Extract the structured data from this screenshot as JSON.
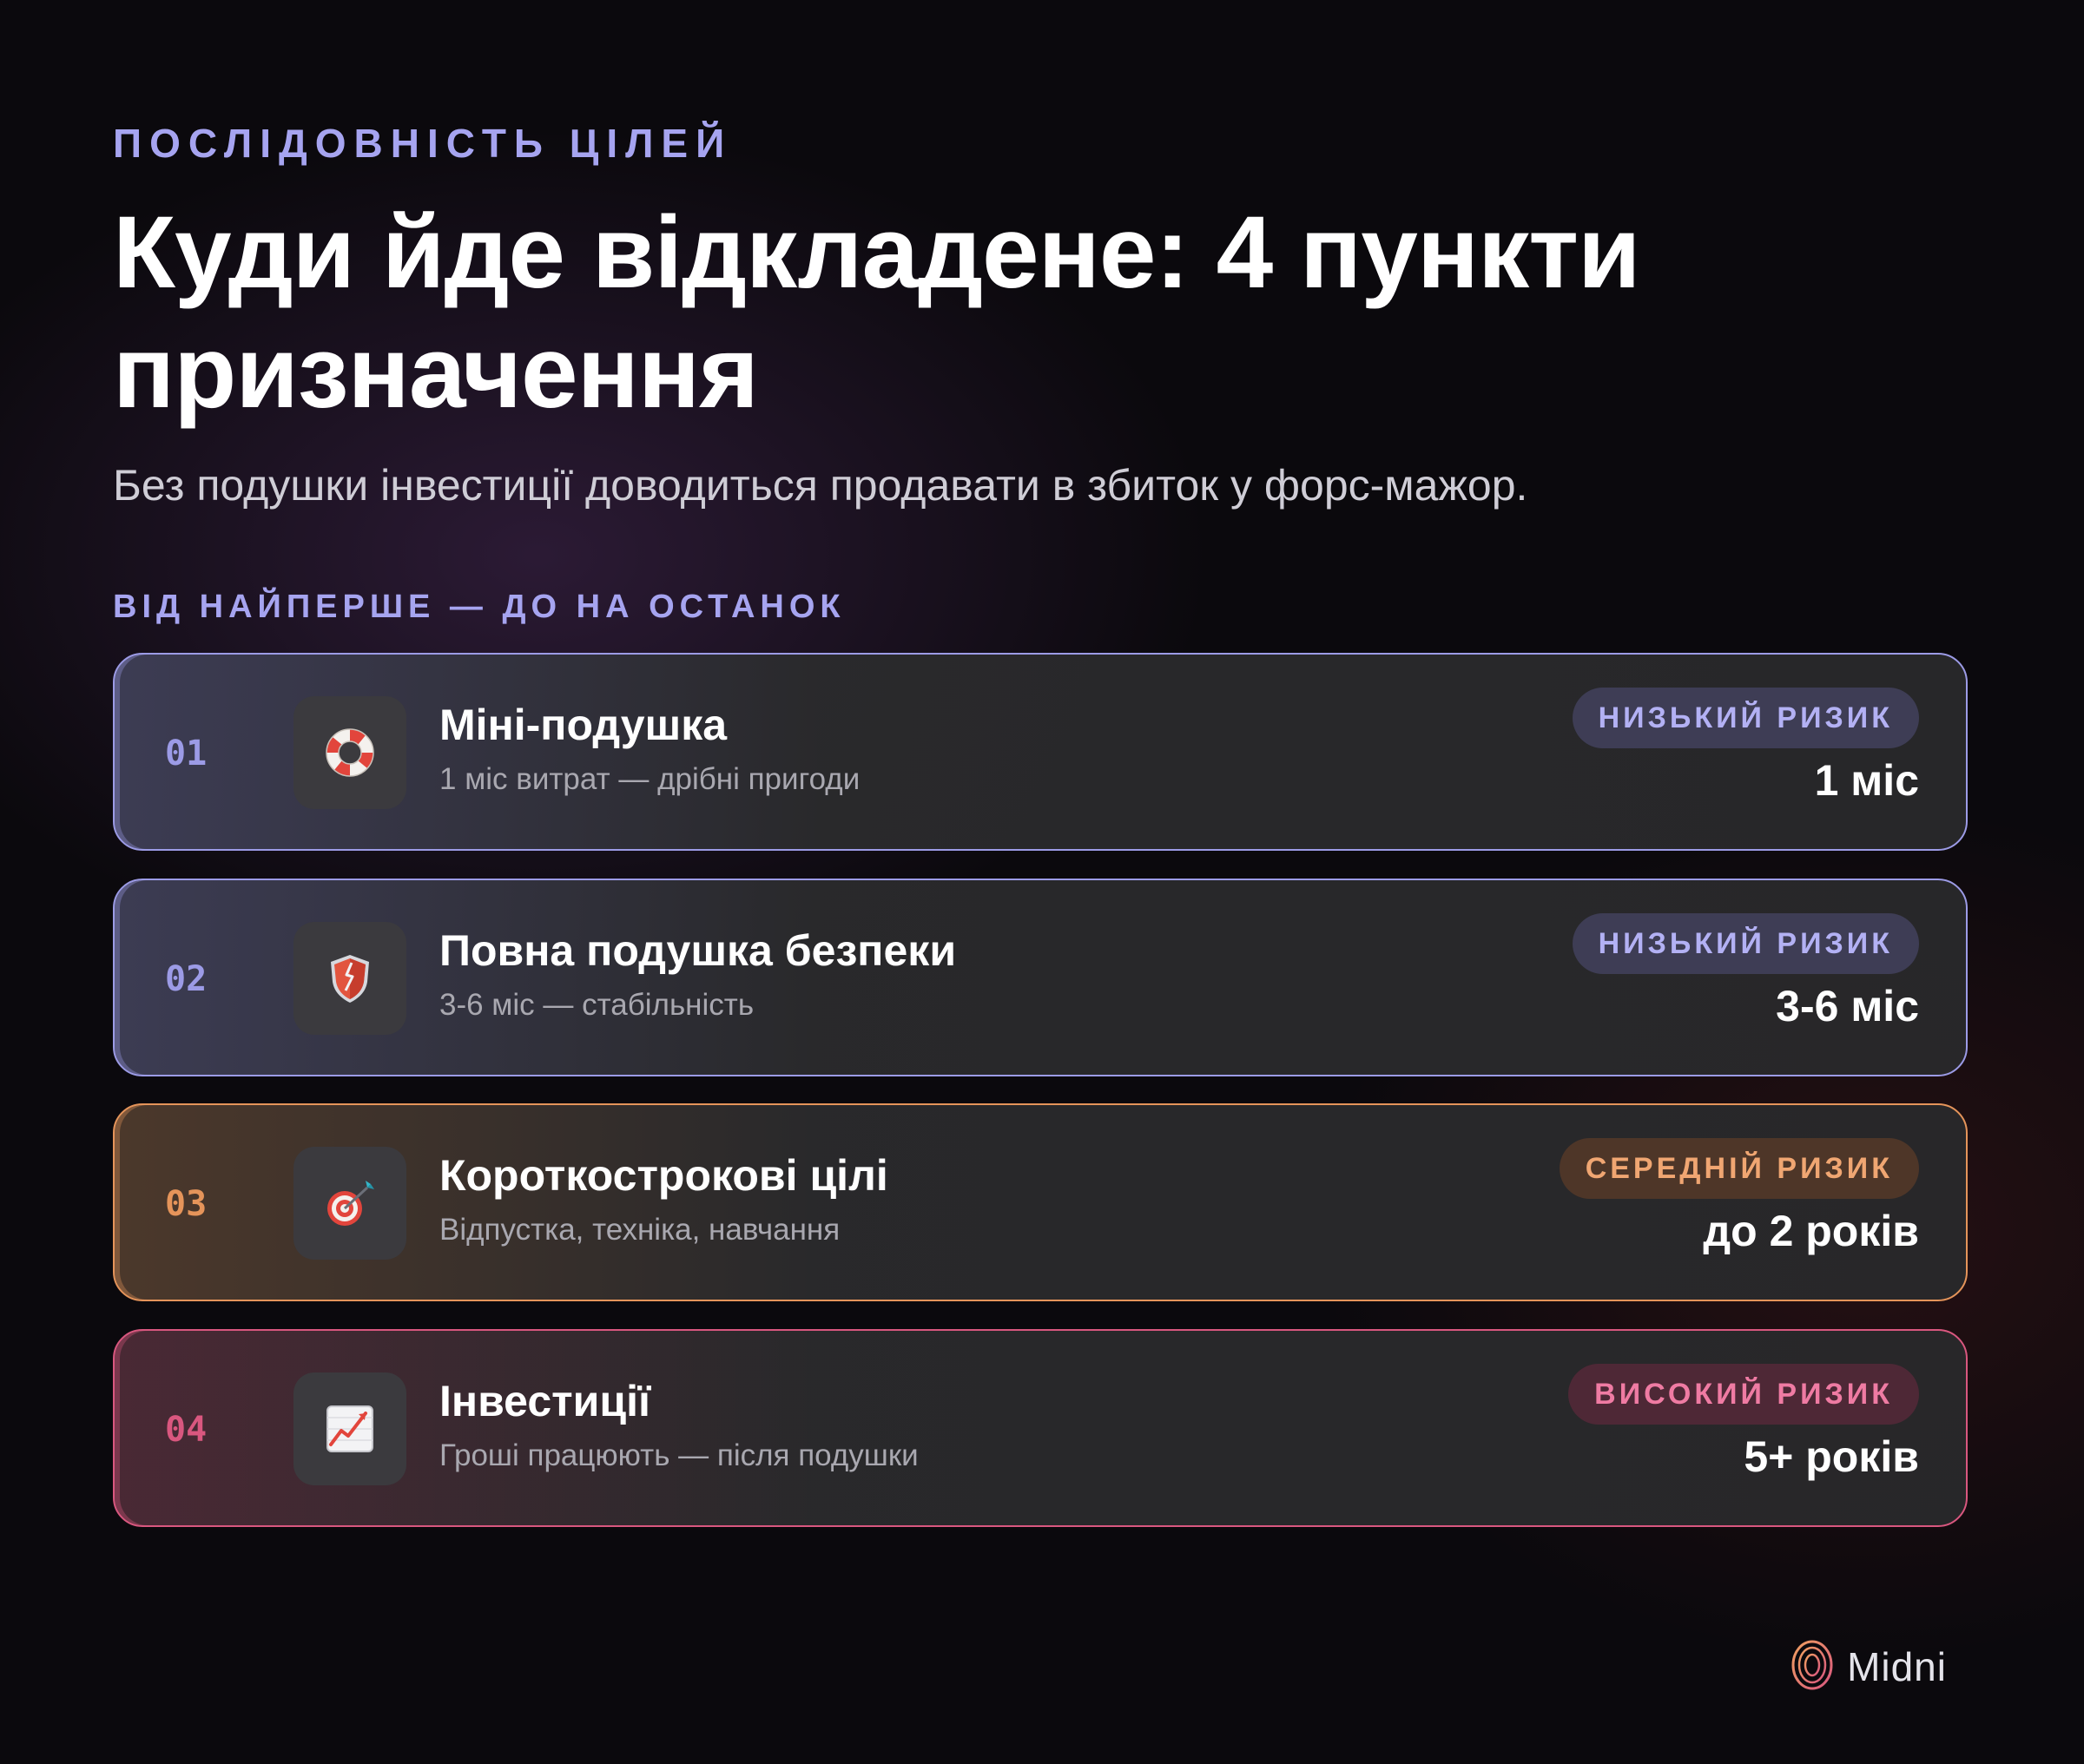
{
  "header": {
    "eyebrow": "ПОСЛІДОВНІСТЬ ЦІЛЕЙ",
    "title": "Куди йде відкладене: 4 пункти призначення",
    "subtitle": "Без подушки інвестиції доводиться продавати в збиток у форс-мажор."
  },
  "section_label": "ВІД НАЙПЕРШЕ — ДО НА ОСТАНОК",
  "items": [
    {
      "num": "01",
      "name": "Міні-подушка",
      "desc": "1 міс витрат — дрібні пригоди",
      "risk": "НИЗЬКИЙ РИЗИК",
      "period": "1 міс",
      "icon": "lifebuoy-icon"
    },
    {
      "num": "02",
      "name": "Повна подушка безпеки",
      "desc": "3-6 міс — стабільність",
      "risk": "НИЗЬКИЙ РИЗИК",
      "period": "3-6 міс",
      "icon": "shield-icon"
    },
    {
      "num": "03",
      "name": "Короткострокові цілі",
      "desc": "Відпустка, техніка, навчання",
      "risk": "СЕРЕДНІЙ РИЗИК",
      "period": "до 2 років",
      "icon": "target-icon"
    },
    {
      "num": "04",
      "name": "Інвестиції",
      "desc": "Гроші працюють — після подушки",
      "risk": "ВИСОКИЙ РИЗИК",
      "period": "5+ років",
      "icon": "chart-increasing-icon"
    }
  ],
  "colors": {
    "low_risk": "#9c9be6",
    "medium_risk": "#e5945a",
    "high_risk": "#d9577f"
  },
  "brand": {
    "name": "Midni",
    "icon": "brand-logo-icon"
  }
}
